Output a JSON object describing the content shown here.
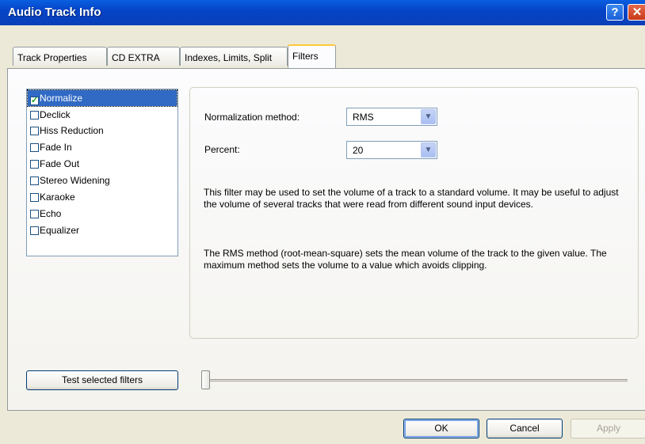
{
  "window": {
    "title": "Audio Track Info",
    "help_label": "?",
    "close_label": "✕"
  },
  "tabs": [
    {
      "label": "Track Properties",
      "active": false
    },
    {
      "label": "CD EXTRA",
      "active": false
    },
    {
      "label": "Indexes, Limits, Split",
      "active": false
    },
    {
      "label": "Filters",
      "active": true
    }
  ],
  "filters": [
    {
      "label": "Normalize",
      "checked": true,
      "selected": true
    },
    {
      "label": "Declick",
      "checked": false,
      "selected": false
    },
    {
      "label": "Hiss Reduction",
      "checked": false,
      "selected": false
    },
    {
      "label": "Fade In",
      "checked": false,
      "selected": false
    },
    {
      "label": "Fade Out",
      "checked": false,
      "selected": false
    },
    {
      "label": "Stereo Widening",
      "checked": false,
      "selected": false
    },
    {
      "label": "Karaoke",
      "checked": false,
      "selected": false
    },
    {
      "label": "Echo",
      "checked": false,
      "selected": false
    },
    {
      "label": "Equalizer",
      "checked": false,
      "selected": false
    }
  ],
  "settings": {
    "method_label": "Normalization method:",
    "method_value": "RMS",
    "percent_label": "Percent:",
    "percent_value": "20",
    "description_1": "This filter may be used to set the volume of a track to a standard volume. It may be useful to adjust the volume of several tracks that were read from different sound input devices.",
    "description_2": "The RMS method (root-mean-square) sets the mean volume of the track to the given value. The maximum method sets the volume to a value which avoids clipping."
  },
  "test_button": "Test selected filters",
  "slider": {
    "value_fraction": 0.0
  },
  "footer": {
    "ok": "OK",
    "cancel": "Cancel",
    "apply": "Apply"
  }
}
